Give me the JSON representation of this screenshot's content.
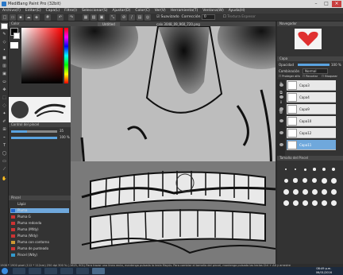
{
  "titlebar": {
    "title": "MediBang Paint Pro (32bit)"
  },
  "menu": [
    "Archivo(F)",
    "Editar(E)",
    "Capa(L)",
    "Filtro(I)",
    "Seleccionar(S)",
    "Ajustar(D)",
    "Color(C)",
    "Ver(V)",
    "Herramienta(T)",
    "Ventana(W)",
    "Ayuda(H)"
  ],
  "toolbar": {
    "suavizado_label": "Suavizado",
    "correccion_label": "Corrección",
    "correccion_value": "0",
    "textura_label": "Textura Espesor"
  },
  "panels": {
    "color_title": "Color",
    "brush_control_title": "Control del pincel",
    "brush_size_value": "35",
    "brush_opacity_value": "100 %",
    "brush_title": "Pincel",
    "navigator_title": "Navegador",
    "layer_title": "Capa",
    "size_title": "Tamaño del Pincel"
  },
  "canvas": {
    "tab_label": "Untitled",
    "doc_title": "calv 3048_09_960_720.png"
  },
  "brushes": [
    {
      "name": "Lápiz",
      "color": "#333333"
    },
    {
      "name": "Pluma",
      "color": "#2266cc",
      "selected": true
    },
    {
      "name": "Pluma G",
      "color": "#cc3333"
    },
    {
      "name": "Pluma redonda",
      "color": "#cc3333"
    },
    {
      "name": "Pluma (Mfdy)",
      "color": "#cc3333"
    },
    {
      "name": "Pluma (Wdy)",
      "color": "#cc3333"
    },
    {
      "name": "Pluma con contorno",
      "color": "#cc9933"
    },
    {
      "name": "Pluma de punteado",
      "color": "#cc3333"
    },
    {
      "name": "Pincel (Wdy)",
      "color": "#3399cc"
    }
  ],
  "layers": {
    "opacity_label": "Opacidad",
    "opacity_value": "100 %",
    "blend_label": "Combinación",
    "blend_value": "Normal",
    "protect_label": "Proteger alfa",
    "clip_label": "Recortar",
    "lock_label": "Bloquear",
    "items": [
      "Capa3",
      "Capa4",
      "Capa9",
      "Capa10",
      "Capa12",
      "Capa11"
    ],
    "selected": "Capa11"
  },
  "statusbar": {
    "text": "1908 * 1900 pixel  (112 * 112cm)  250 dpi  300 %  (-1625, 901)  Para trazar una línea recta, mantenga pulsada la tecla Mayús. Para cambiar el tamaño del pincel, mantenga pulsada las teclas Ctrl + Alt y arrastre"
  },
  "taskbar": {
    "time": "08:49 p.m.",
    "date": "06/01/2016"
  },
  "colors": {
    "accent": "#5aa3e0",
    "selected_layer": "#6fa8dc",
    "heart": "#e03030"
  }
}
